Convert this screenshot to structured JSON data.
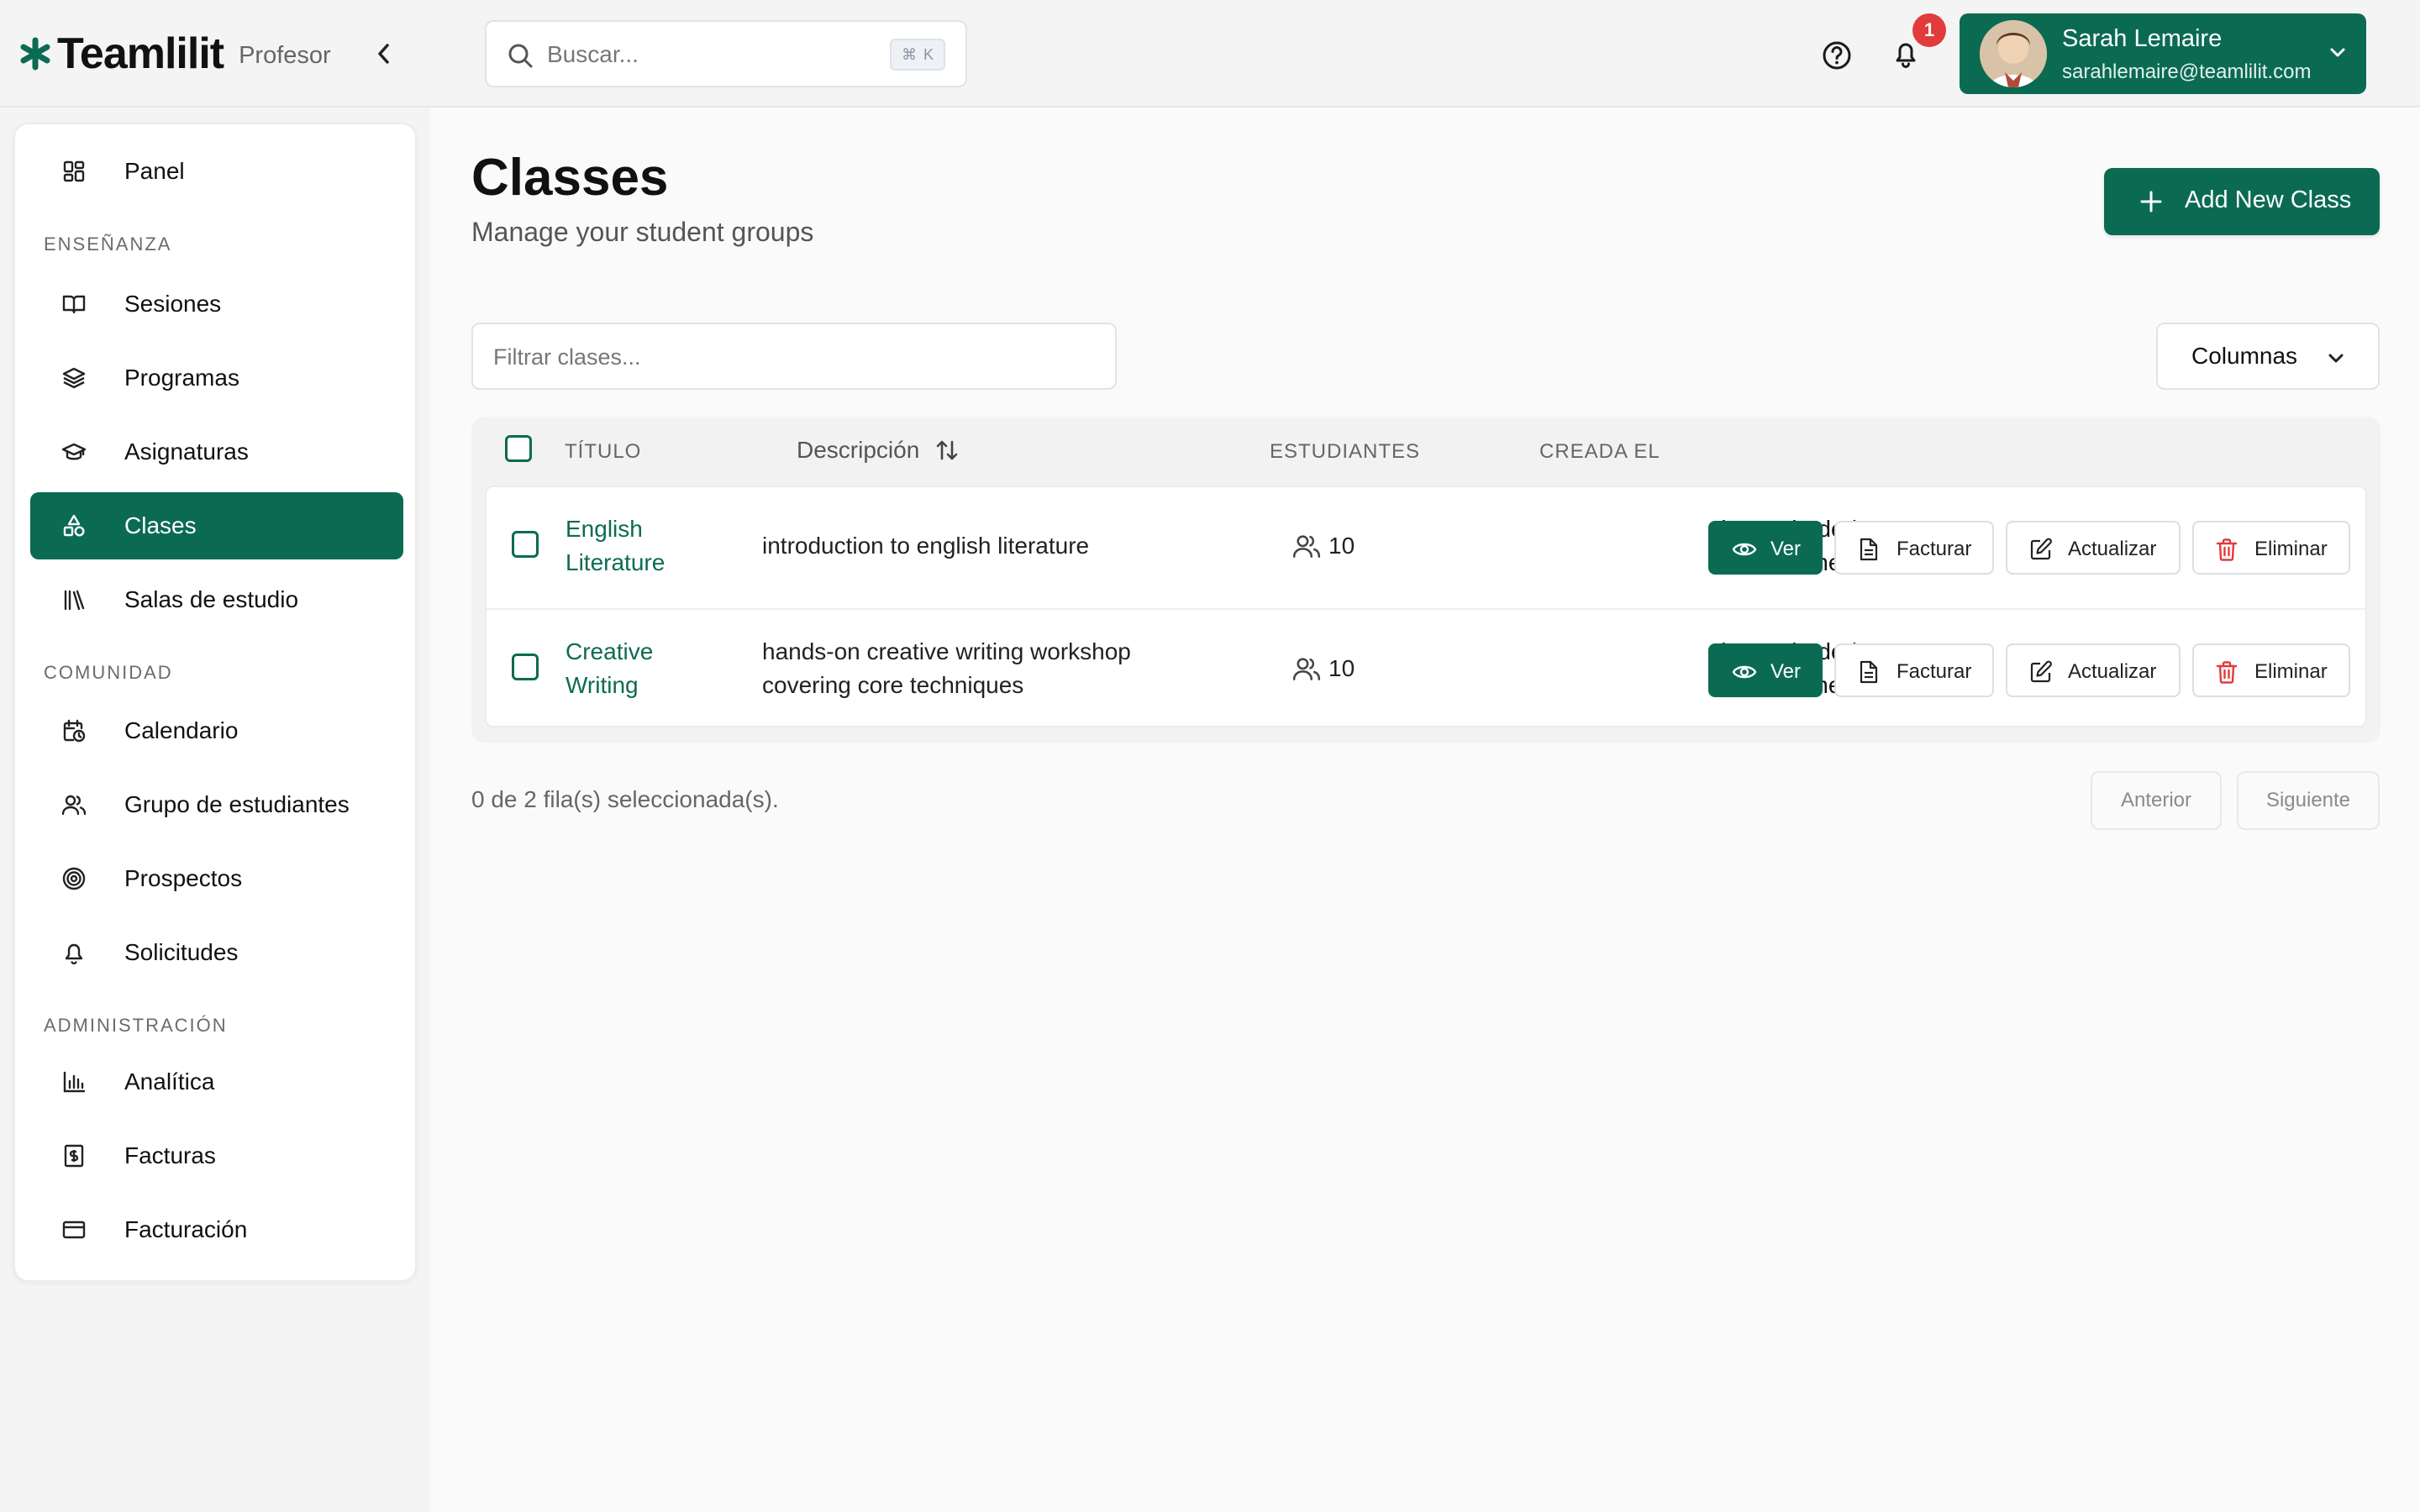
{
  "app": {
    "brand": "Teamlilit",
    "role": "Profesor"
  },
  "search": {
    "placeholder": "Buscar...",
    "shortcut_symbol": "⌘",
    "shortcut_key": "K"
  },
  "notifications": {
    "count": "1"
  },
  "user": {
    "name": "Sarah Lemaire",
    "email": "sarahlemaire@teamlilit.com"
  },
  "sidebar": {
    "top_item": {
      "label": "Panel",
      "icon": "dashboard-icon"
    },
    "sections": [
      {
        "label": "ENSEÑANZA",
        "items": [
          {
            "label": "Sesiones",
            "icon": "book-open-icon"
          },
          {
            "label": "Programas",
            "icon": "layers-icon"
          },
          {
            "label": "Asignaturas",
            "icon": "graduation-cap-icon"
          },
          {
            "label": "Clases",
            "icon": "shapes-icon",
            "active": true
          },
          {
            "label": "Salas de estudio",
            "icon": "library-icon"
          }
        ]
      },
      {
        "label": "COMUNIDAD",
        "items": [
          {
            "label": "Calendario",
            "icon": "calendar-clock-icon"
          },
          {
            "label": "Grupo de estudiantes",
            "icon": "users-icon"
          },
          {
            "label": "Prospectos",
            "icon": "target-icon"
          },
          {
            "label": "Solicitudes",
            "icon": "bell-icon"
          }
        ]
      },
      {
        "label": "ADMINISTRACIÓN",
        "items": [
          {
            "label": "Analítica",
            "icon": "bar-chart-icon"
          },
          {
            "label": "Facturas",
            "icon": "receipt-icon"
          },
          {
            "label": "Facturación",
            "icon": "credit-card-icon"
          }
        ]
      }
    ]
  },
  "page": {
    "title": "Classes",
    "subtitle": "Manage your student groups",
    "add_button": "Add New Class",
    "filter_placeholder": "Filtrar clases...",
    "columns_button": "Columnas"
  },
  "table": {
    "headers": {
      "title": "TÍTULO",
      "description": "Descripción",
      "students": "ESTUDIANTES",
      "created": "CREADA EL"
    },
    "rows": [
      {
        "title_line1": "English",
        "title_line2": "Literature",
        "description_line1": "introduction to english literature",
        "description_line2": "",
        "students": "10",
        "created_line1": "hace alrededor",
        "created_line2": "de 2 meses"
      },
      {
        "title_line1": "Creative",
        "title_line2": "Writing",
        "description_line1": "hands-on creative writing workshop",
        "description_line2": "covering core techniques",
        "students": "10",
        "created_line1": "hace alrededor",
        "created_line2": "de 2 meses"
      }
    ],
    "actions": {
      "view": "Ver",
      "invoice": "Facturar",
      "update": "Actualizar",
      "delete": "Eliminar"
    }
  },
  "footer": {
    "selection_status": "0 de 2 fila(s) seleccionada(s).",
    "prev": "Anterior",
    "next": "Siguiente"
  },
  "colors": {
    "brand_green": "#0b6b52",
    "danger_red": "#e23b3b"
  }
}
